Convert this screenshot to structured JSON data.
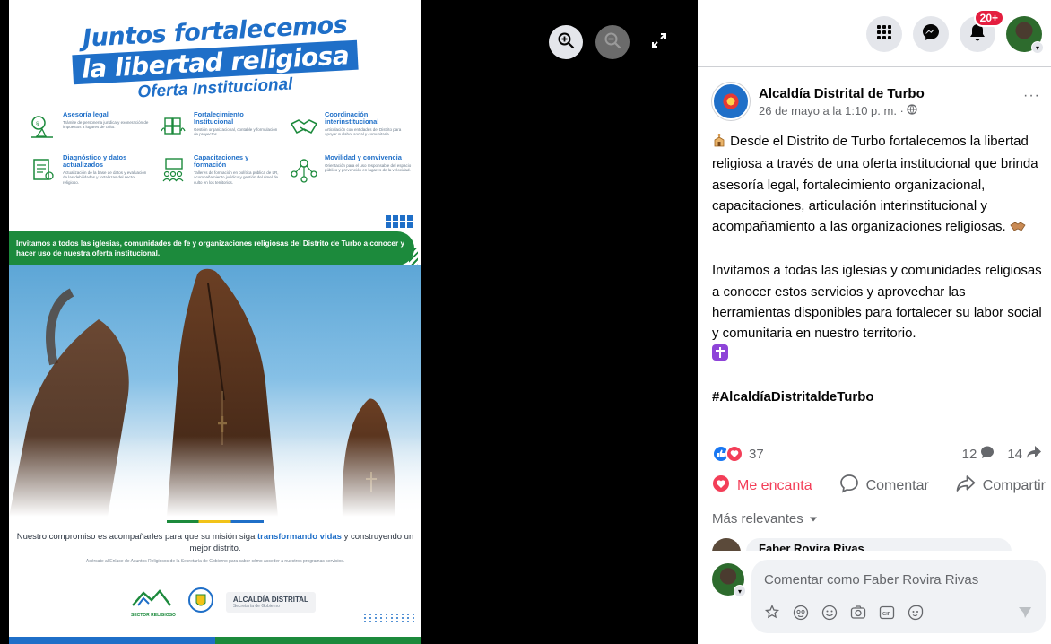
{
  "viewer": {
    "controls": [
      "zoom-in",
      "zoom-out",
      "expand"
    ]
  },
  "poster": {
    "title_line1": "Juntos fortalecemos",
    "title_line2": "la libertad religiosa",
    "title_line3": "Oferta Institucional",
    "services": [
      {
        "title": "Asesoría legal",
        "desc": "Trámite de personería jurídica y exoneración de impuestos a lugares de culto.",
        "icon": "scales-icon"
      },
      {
        "title": "Fortalecimiento Institucional",
        "desc": "Gestión organizacional, contable y formulación de proyectos.",
        "icon": "puzzle-hands-icon"
      },
      {
        "title": "Coordinación interinstitucional",
        "desc": "Articulación con entidades del Distrito para apoyar su labor social y comunitaria.",
        "icon": "handshake-icon"
      },
      {
        "title": "Diagnóstico y datos actualizados",
        "desc": "Actualización de la base de datos y evaluación de las debilidades y fortalezas del sector religioso.",
        "icon": "clipboard-icon"
      },
      {
        "title": "Capacitaciones y formación",
        "desc": "Talleres de formación en política pública de LR, acompañamiento jurídico y gestión del rimel de culto en los territorios.",
        "icon": "classroom-icon"
      },
      {
        "title": "Movilidad y convivencia",
        "desc": "Orientación para el uso responsable del espacio público y prevención en lugares de la velocidad.",
        "icon": "network-icon"
      }
    ],
    "band_text": "Invitamos a todos las iglesias, comunidades de fe y organizaciones religiosas del Distrito de Turbo a conocer y hacer uso de nuestra oferta institucional.",
    "commitment_pre": "Nuestro compromiso es acompañarles para que su misión siga ",
    "commitment_emph": "transformando vidas",
    "commitment_post": " y construyendo un mejor distrito.",
    "small_text": "Acércate al Enlace de Asuntos Religiosos de la Secretaría de Gobierno para saber cómo acceder a nuestros programas servicios.",
    "logo1_label": "SECTOR RELIGIOSO",
    "logo3_line1": "ALCALDÍA DISTRITAL",
    "logo3_line2": "Secretaría de Gobierno"
  },
  "topbar": {
    "notification_badge": "20+",
    "icons": [
      "menu-grid-icon",
      "messenger-icon",
      "bell-icon"
    ]
  },
  "post": {
    "page_name": "Alcaldía Distrital de Turbo",
    "date": "26 de mayo a la 1:10 p. m. ·",
    "more": "···",
    "paragraph1": "Desde el Distrito de Turbo fortalecemos la libertad religiosa a través de una oferta institucional que brinda asesoría legal, fortalecimiento organizacional, capacitaciones, articulación interinstitucional y acompañamiento a las organizaciones religiosas.",
    "paragraph2": "Invitamos a todas las iglesias y comunidades religiosas a conocer estos servicios y aprovechar las herramientas disponibles para fortalecer su labor social y comunitaria en nuestro territorio.",
    "hashtag": "#AlcaldíaDistritaldeTurbo",
    "reactions_count": "37",
    "comments_count": "12",
    "shares_count": "14"
  },
  "actions": {
    "love_label": "Me encanta",
    "comment_label": "Comentar",
    "share_label": "Compartir"
  },
  "comments": {
    "sort_label": "Más relevantes",
    "peek_name": "Faber Rovira Rivas",
    "composer_placeholder": "Comentar como Faber Rovira Rivas"
  },
  "colors": {
    "facebook_blue": "#1877f2",
    "love_red": "#f33e58",
    "poster_blue": "#1f6fc8",
    "poster_green": "#1c8a3c"
  }
}
